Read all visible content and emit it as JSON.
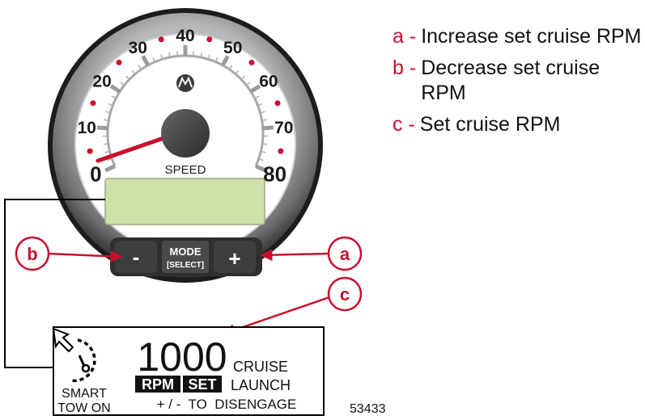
{
  "gauge": {
    "dial_numbers": [
      "0",
      "10",
      "20",
      "30",
      "40",
      "50",
      "60",
      "70",
      "80"
    ],
    "dial_label": "SPEED",
    "buttons": {
      "minus": "-",
      "mode": "MODE",
      "select": "[SELECT]",
      "plus": "+"
    }
  },
  "callouts": {
    "a": "a",
    "b": "b",
    "c": "c"
  },
  "screen": {
    "rpm_value": "1000",
    "cruise": "CRUISE",
    "rpm_tag": "RPM",
    "set_tag": "SET",
    "launch": "LAUNCH",
    "smart": "SMART",
    "tow_on": "TOW ON",
    "hint": "+ / -  TO  DISENGAGE"
  },
  "legend": [
    {
      "key": "a -",
      "text": "Increase set cruise RPM"
    },
    {
      "key": "b -",
      "text": "Decrease set cruise RPM"
    },
    {
      "key": "c -",
      "text": "Set cruise RPM"
    }
  ],
  "figure_number": "53433",
  "colors": {
    "accent_red": "#c8102e",
    "lcd_green": "#cfe0a8",
    "bezel_gray": "#8c8c8c"
  }
}
